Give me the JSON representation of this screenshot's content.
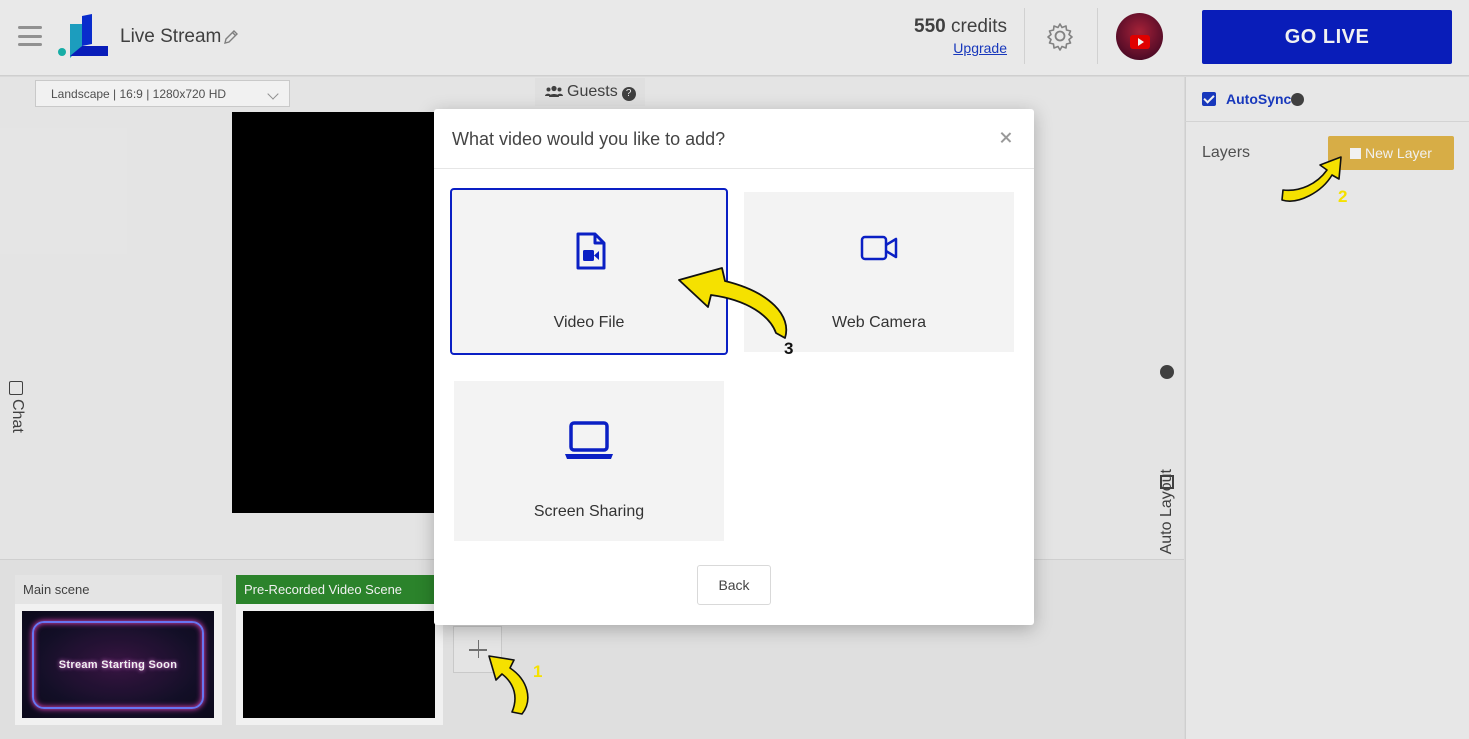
{
  "header": {
    "title": "Live Stream",
    "credits_value": "550",
    "credits_label": "credits",
    "upgrade_label": "Upgrade",
    "go_live_label": "GO LIVE"
  },
  "stage": {
    "resolution": "Landscape | 16:9 | 1280x720 HD",
    "guests_label": "Guests",
    "chat_label": "Chat",
    "auto_layout_label": "Auto Layout"
  },
  "right_panel": {
    "autosync_label": "AutoSync",
    "autosync_checked": true,
    "layers_label": "Layers",
    "new_layer_label": "New Layer"
  },
  "scenes": [
    {
      "title": "Main scene",
      "thumbnail_text": "Stream Starting Soon"
    },
    {
      "title": "Pre-Recorded Video Scene",
      "thumbnail_text": ""
    }
  ],
  "modal": {
    "title": "What video would you like to add?",
    "options": [
      {
        "label": "Video File",
        "icon": "video-file-icon"
      },
      {
        "label": "Web Camera",
        "icon": "video-camera-icon"
      },
      {
        "label": "Screen Sharing",
        "icon": "laptop-icon"
      }
    ],
    "back_label": "Back"
  },
  "annotations": {
    "step1": "1",
    "step2": "2",
    "step3": "3"
  },
  "colors": {
    "accent": "#0a1fc4",
    "new_layer": "#e4b84b",
    "scene_active": "#2e8b2e",
    "arrow": "#f5e100"
  }
}
